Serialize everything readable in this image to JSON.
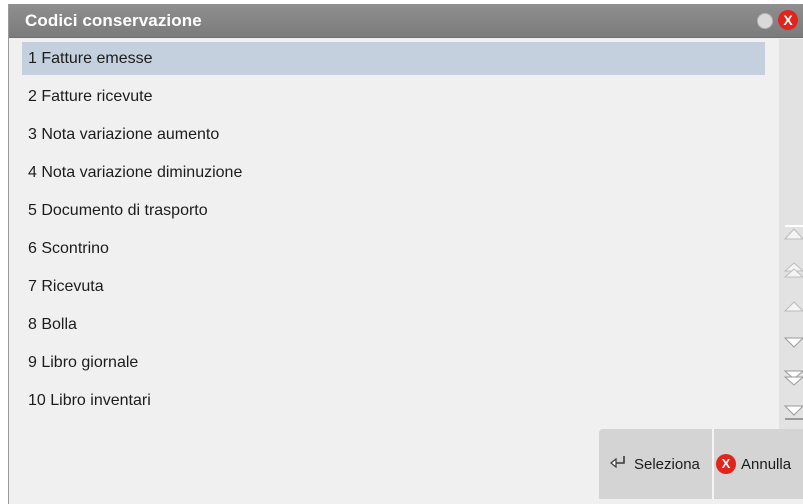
{
  "window": {
    "title": "Codici conservazione",
    "close_glyph": "X"
  },
  "list": {
    "selected_index": 0,
    "items": [
      "1 Fatture emesse",
      "2 Fatture ricevute",
      "3 Nota variazione aumento",
      "4 Nota variazione diminuzione",
      "5 Documento di trasporto",
      "6 Scontrino",
      "7 Ricevuta",
      "8 Bolla",
      "9 Libro giornale",
      "10 Libro inventari"
    ]
  },
  "footer": {
    "select_label": "Seleziona",
    "cancel_label": "Annulla",
    "select_icon": "enter-arrow-icon",
    "cancel_icon": "red-x-icon"
  },
  "colors": {
    "titlebar": "#858585",
    "selection": "#c5d0de",
    "close": "#e2241c"
  }
}
